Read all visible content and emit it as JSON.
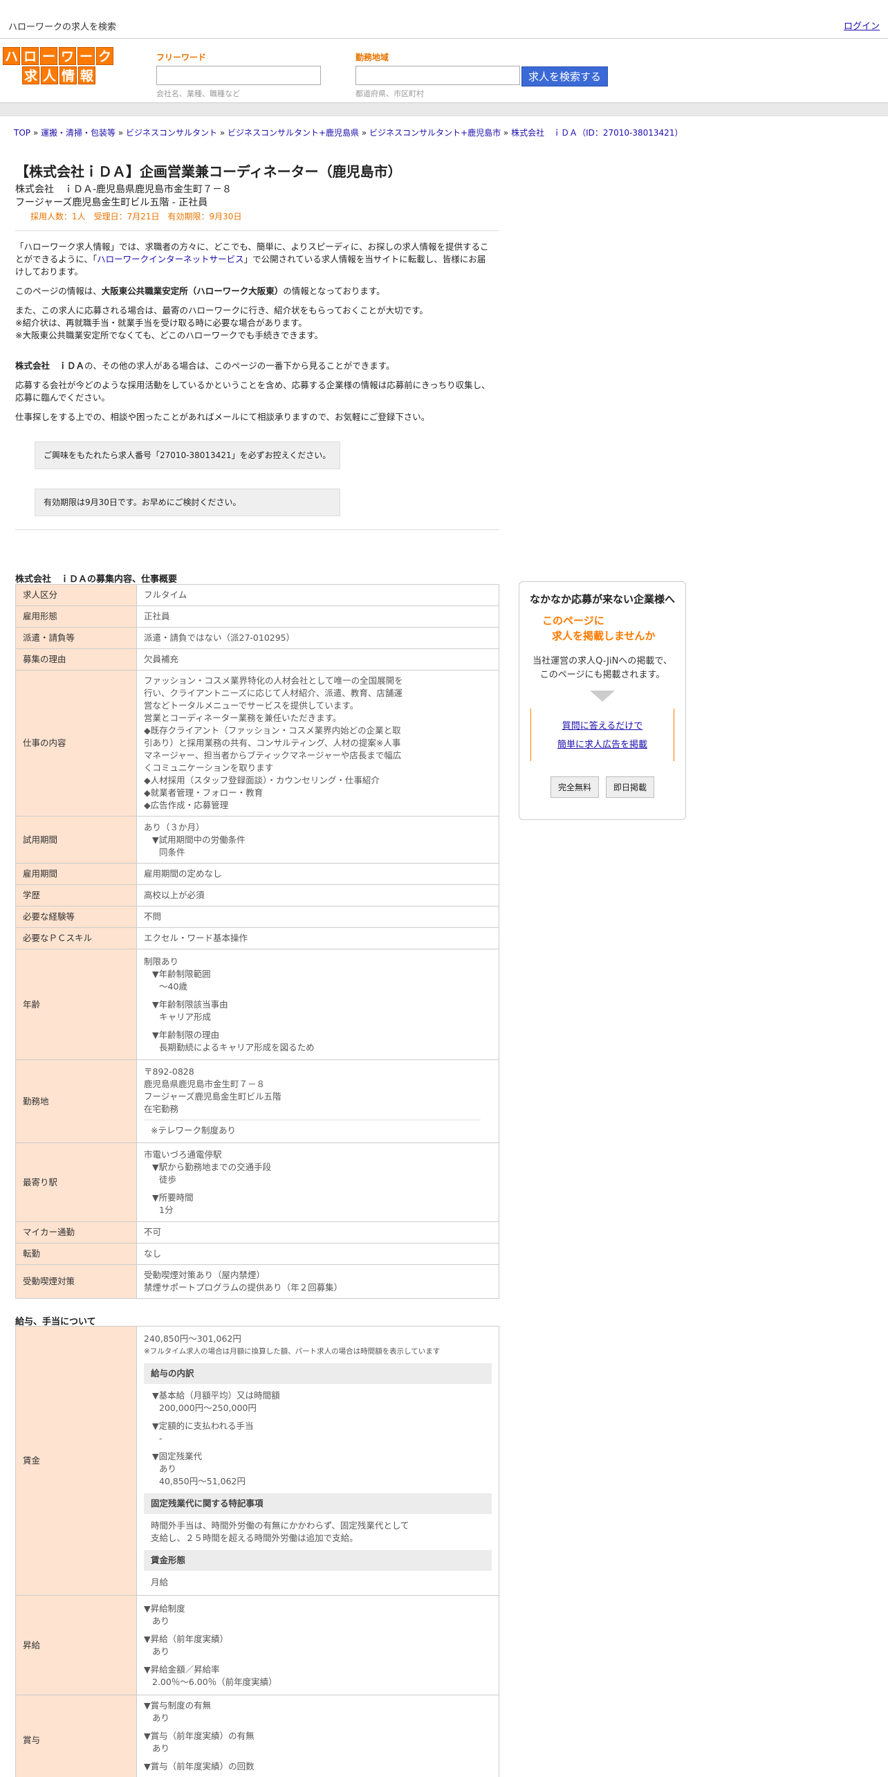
{
  "topbar": {
    "site_title": "ハローワークの求人を検索",
    "login": "ログイン"
  },
  "logo": {
    "row1": [
      "ハ",
      "ロ",
      "ー",
      "ワ",
      "ー",
      "ク"
    ],
    "row2": [
      "求",
      "人",
      "情",
      "報"
    ]
  },
  "search": {
    "freeword_label": "フリーワード",
    "freeword_value": "",
    "freeword_hint": "会社名、業種、職種など",
    "area_label": "勤務地域",
    "area_value": "",
    "area_hint": "都道府県、市区町村",
    "button": "求人を検索する"
  },
  "breadcrumb": [
    {
      "text": "TOP"
    },
    {
      "text": "運搬・清掃・包装等"
    },
    {
      "text": "ビジネスコンサルタント"
    },
    {
      "text": "ビジネスコンサルタント+鹿児島県"
    },
    {
      "text": "ビジネスコンサルタント+鹿児島市"
    },
    {
      "text": "株式会社　ｉＤＡ（ID：27010-38013421）"
    }
  ],
  "breadcrumb_sep": " » ",
  "job": {
    "title": "【株式会社ｉＤＡ】企画営業兼コーディネーター（鹿児島市）",
    "line1": "株式会社　ｉＤＡ-鹿児島県鹿児島市金生町７－８",
    "line2": "フージャーズ鹿児島金生町ビル五階 - 正社員",
    "meta": "採用人数：1人　受理日：7月21日　有効期限：9月30日"
  },
  "intro": {
    "p1a": "「ハローワーク求人情報」では、求職者の方々に、どこでも、簡単に、よりスピーディに、お探しの求人情報を提供することができるように、「",
    "p1link": "ハローワークインターネットサービス",
    "p1b": "」で公開されている求人情報を当サイトに転載し、皆様にお届けしております。",
    "p2a": "このページの情報は、",
    "p2b": "大阪東公共職業安定所（ハローワーク大阪東）",
    "p2c": "の情報となっております。",
    "p3": "また、この求人に応募される場合は、最寄のハローワークに行き、紹介状をもらっておくことが大切です。",
    "p4": "※紹介状は、再就職手当・就業手当を受け取る時に必要な場合があります。",
    "p5": "※大阪東公共職業安定所でなくても、どこのハローワークでも手続きできます。",
    "p6a": "株式会社　ｉＤＡ",
    "p6b": "の、その他の求人がある場合は、このページの一番下から見ることができます。",
    "p7": "応募する会社が今どのような採用活動をしているかということを含め、応募する企業様の情報は応募前にきっちり収集し、応募に臨んでください。",
    "p8": "仕事探しをする上での、相談や困ったことがあればメールにて相談承りますので、お気軽にご登録下さい。"
  },
  "notice1": "ご興味をもたれたら求人番号「27010-38013421」を必ずお控えください。",
  "notice2": "有効期限は9月30日です。お早めにご検討ください。",
  "section1_title": "株式会社　ｉＤＡの募集内容、仕事概要",
  "rows": {
    "kubun": {
      "h": "求人区分",
      "v": "フルタイム"
    },
    "koyo": {
      "h": "雇用形態",
      "v": "正社員"
    },
    "haken": {
      "h": "派遣・請負等",
      "v": "派遣・請負ではない（派27-010295）"
    },
    "riyu": {
      "h": "募集の理由",
      "v": "欠員補充"
    },
    "naiyo": {
      "h": "仕事の内容",
      "v": [
        "ファッション・コスメ業界特化の人材会社として唯一の全国展開を",
        "行い、クライアントニーズに応じて人材紹介、派遣、教育、店舗運",
        "営などトータルメニューでサービスを提供しています。",
        "営業とコーディネーター業務を兼任いただきます。",
        "◆既存クライアント（ファッション・コスメ業界内始どの企業と取",
        "引あり）と採用業務の共有、コンサルティング、人材の提案※人事",
        "マネージャー、担当者からブティックマネージャーや店長まで幅広",
        "くコミュニケーションを取ります",
        "◆人材採用（スタッフ登録面談）・カウンセリング・仕事紹介",
        "◆就業者管理・フォロー・教育",
        "◆広告作成・応募管理"
      ]
    },
    "shiyo": {
      "h": "試用期間",
      "v1": "あり（３か月）",
      "v2": "▼試用期間中の労働条件",
      "v3": "同条件"
    },
    "kikan": {
      "h": "雇用期間",
      "v": "雇用期間の定めなし"
    },
    "gakureki": {
      "h": "学歴",
      "v": "高校以上が必須"
    },
    "keiken": {
      "h": "必要な経験等",
      "v": "不問"
    },
    "pc": {
      "h": "必要なＰＣスキル",
      "v": "エクセル・ワード基本操作"
    },
    "nenrei": {
      "h": "年齢",
      "v1": "制限あり",
      "v2": "▼年齢制限範囲",
      "v3": "〜40歳",
      "v4": "▼年齢制限該当事由",
      "v5": "キャリア形成",
      "v6": "▼年齢制限の理由",
      "v7": "長期勤続によるキャリア形成を図るため"
    },
    "kinmuchi": {
      "h": "勤務地",
      "v1": "〒892-0828",
      "v2": "鹿児島県鹿児島市金生町７－８",
      "v3": "フージャーズ鹿児島金生町ビル五階",
      "v4": "在宅勤務",
      "v5": "※テレワーク制度あり"
    },
    "eki": {
      "h": "最寄り駅",
      "v1": "市電いづろ通電停駅",
      "v2": "▼駅から勤務地までの交通手段",
      "v3": "徒歩",
      "v4": "▼所要時間",
      "v5": "1分"
    },
    "maika": {
      "h": "マイカー通勤",
      "v": "不可"
    },
    "tenkin": {
      "h": "転勤",
      "v": "なし"
    },
    "kitsuen": {
      "h": "受動喫煙対策",
      "v1": "受動喫煙対策あり（屋内禁煙）",
      "v2": "禁煙サポートプログラムの提供あり（年２回募集）"
    }
  },
  "section2_title": "給与、手当について",
  "pay": {
    "chingin": {
      "h": "賃金",
      "range": "240,850円〜301,062円",
      "note": "※フルタイム求人の場合は月額に換算した額、パート求人の場合は時間額を表示しています",
      "box1": "給与の内訳",
      "k1": "▼基本給（月額平均）又は時間額",
      "k1v": "200,000円〜250,000円",
      "k2": "▼定額的に支払われる手当",
      "k2v": "-",
      "k3": "▼固定残業代",
      "k3v1": "あり",
      "k3v2": "40,850円〜51,062円",
      "box2": "固定残業代に関する特記事項",
      "tokki1": "時間外手当は、時間外労働の有無にかかわらず、固定残業代として",
      "tokki2": "支給し、２５時間を超える時間外労働は追加で支給。",
      "box3": "賃金形態",
      "keitai": "月給"
    },
    "shokyu": {
      "h": "昇給",
      "a": "▼昇給制度",
      "av": "あり",
      "b": "▼昇給（前年度実績）",
      "bv": "あり",
      "c": "▼昇給金額／昇給率",
      "cv": "2.00％〜6.00％（前年度実績）"
    },
    "shoyo": {
      "h": "賞与",
      "a": "▼賞与制度の有無",
      "av": "あり",
      "b": "▼賞与（前年度実績）の有無",
      "bv": "あり",
      "c": "▼賞与（前年度実績）の回数"
    }
  },
  "ad": {
    "t1": "なかなか応募が来ない企業様へ",
    "t2a": "このページに",
    "t2b": "求人を掲載しませんか",
    "t3a": "当社運営の求人Q-JiNへの掲載で、",
    "t3b": "このページにも掲載されます。",
    "link1": "質問に答えるだけで",
    "link2": "簡単に求人広告を掲載",
    "btn1": "完全無料",
    "btn2": "即日掲載"
  }
}
